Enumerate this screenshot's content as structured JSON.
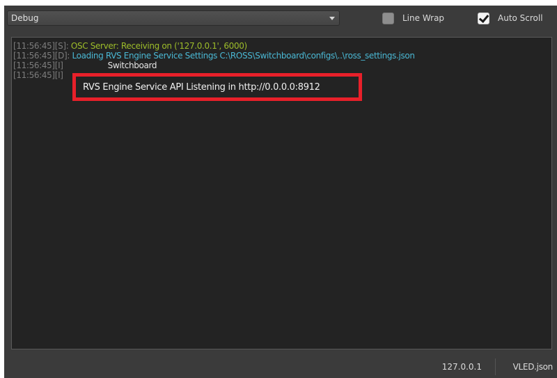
{
  "toolbar": {
    "log_level": "Debug",
    "line_wrap": {
      "label": "Line Wrap",
      "checked": false
    },
    "auto_scroll": {
      "label": "Auto Scroll",
      "checked": true
    }
  },
  "log": {
    "lines": [
      {
        "timestamp": "[11:56:45]",
        "level": "[S]",
        "separator": ":",
        "message": "OSC Server: Receiving on ('127.0.0.1', 6000)"
      },
      {
        "timestamp": "[11:56:45]",
        "level": "[D]",
        "separator": ":",
        "message": "Loading RVS Engine Service Settings C:\\ROSS\\Switchboard\\configs\\..\\ross_settings.json"
      },
      {
        "timestamp": "[11:56:45]",
        "level": "[I]",
        "separator": "",
        "message": "Switchboard"
      },
      {
        "timestamp": "[11:56:45]",
        "level": "[I]",
        "separator": "",
        "message": ""
      }
    ],
    "highlighted_message": "RVS Engine Service API Listening in http://0.0.0.0:8912"
  },
  "colors": {
    "highlight": "#e8202a",
    "success_text": "#9dbd2a",
    "debug_text": "#4ab8d4",
    "info_text": "#e6e6e6"
  },
  "statusbar": {
    "ip": "127.0.0.1",
    "config_file": "VLED.json"
  }
}
